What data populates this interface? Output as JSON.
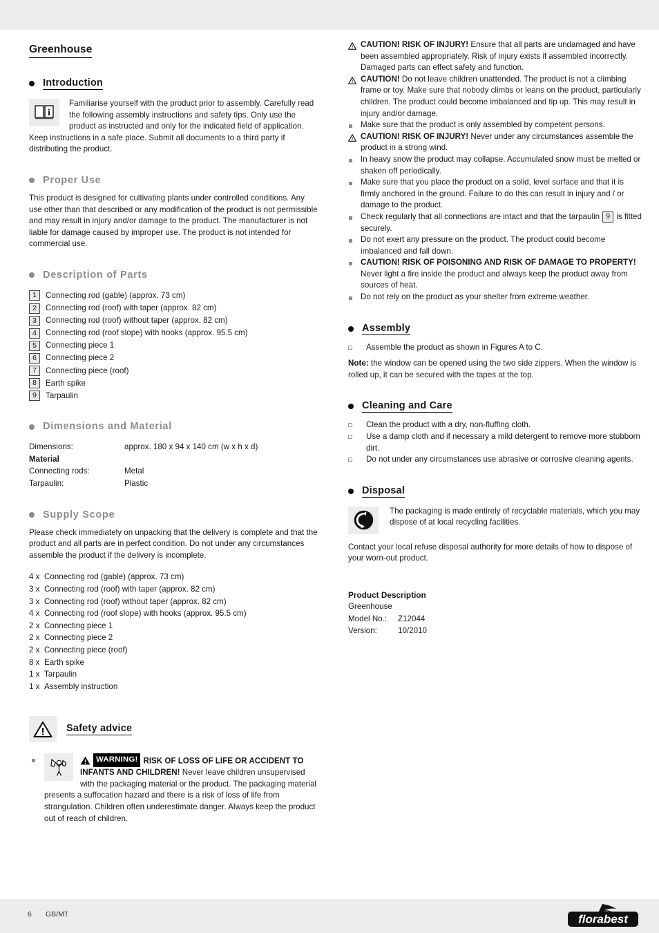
{
  "document": {
    "title": "Greenhouse"
  },
  "sections": {
    "introduction": {
      "heading": "Introduction",
      "icon": "manual-book-icon",
      "body": "Familiarise yourself with the product prior to assembly. Carefully read the following assembly instructions and safety tips. Only use the product as instructed and only for the indicated field of application. Keep instructions in a safe place. Submit all documents to a third party if distributing the product."
    },
    "proper_use": {
      "heading": "Proper Use",
      "body": "This product is designed for cultivating plants under controlled conditions. Any use other than that described or any modification of the product is not permissible and may result in injury and/or damage to the product. The manufacturer is not liable for damage caused by improper use. The product is not intended for commercial use."
    },
    "description_of_parts": {
      "heading": "Description of Parts",
      "parts": [
        {
          "num": "1",
          "label": "Connecting rod (gable) (approx. 73 cm)"
        },
        {
          "num": "2",
          "label": "Connecting rod (roof) with taper (approx. 82 cm)"
        },
        {
          "num": "3",
          "label": "Connecting rod (roof) without taper (approx. 82 cm)"
        },
        {
          "num": "4",
          "label": "Connecting rod (roof slope) with hooks (approx. 95.5 cm)"
        },
        {
          "num": "5",
          "label": "Connecting piece 1"
        },
        {
          "num": "6",
          "label": "Connecting piece 2"
        },
        {
          "num": "7",
          "label": "Connecting piece (roof)"
        },
        {
          "num": "8",
          "label": "Earth spike"
        },
        {
          "num": "9",
          "label": "Tarpaulin"
        }
      ]
    },
    "dimensions_and_material": {
      "heading": "Dimensions and Material",
      "rows": [
        {
          "key": "Dimensions:",
          "value": "approx. 180 x 94 x 140 cm (w x h x d)",
          "bold": false
        },
        {
          "key": "Material",
          "value": "",
          "bold": true
        },
        {
          "key": "Connecting rods:",
          "value": "Metal",
          "bold": false
        },
        {
          "key": "Tarpaulin:",
          "value": "Plastic",
          "bold": false
        }
      ]
    },
    "supply_scope": {
      "heading": "Supply Scope",
      "intro": "Please check immediately on unpacking that the delivery is complete and that the product and all parts are in perfect condition. Do not under any circumstances assemble the product if the delivery is incomplete.",
      "items": [
        {
          "qty": "4 x",
          "label": "Connecting rod (gable) (approx. 73 cm)"
        },
        {
          "qty": "3 x",
          "label": "Connecting rod (roof) with taper (approx. 82 cm)"
        },
        {
          "qty": "3 x",
          "label": "Connecting rod (roof) without taper (approx. 82 cm)"
        },
        {
          "qty": "4 x",
          "label": "Connecting rod (roof slope) with hooks (approx. 95.5 cm)"
        },
        {
          "qty": "2 x",
          "label": "Connecting piece 1"
        },
        {
          "qty": "2 x",
          "label": "Connecting piece 2"
        },
        {
          "qty": "2 x",
          "label": "Connecting piece (roof)"
        },
        {
          "qty": "8 x",
          "label": "Earth spike"
        },
        {
          "qty": "1 x",
          "label": "Tarpaulin"
        },
        {
          "qty": "1 x",
          "label": "Assembly instruction"
        }
      ]
    },
    "safety_advice": {
      "heading": "Safety advice",
      "warning": {
        "badge_word": "WARNING!",
        "bold_lead": "RISK OF LOSS OF LIFE OR ACCIDENT TO INFANTS AND CHILDREN!",
        "rest": " Never leave children unsupervised with the packaging material or the product. The packaging material presents a suffocation hazard and there is a risk of loss of life from strangulation. Children often underestimate danger. Always keep the product out of reach of children."
      }
    },
    "cautions": {
      "items": [
        {
          "mark": "triangle",
          "bold": "CAUTION! RISK OF INJURY!",
          "text": " Ensure that all parts are undamaged and have been assembled appropriately. Risk of injury exists if assembled incorrectly. Damaged parts can effect safety and function."
        },
        {
          "mark": "triangle",
          "bold": "CAUTION!",
          "text": " Do not leave children unattended. The product is not a climbing frame or toy. Make sure that nobody climbs or leans on the product, particularly children. The product could become imbalanced and tip up. This may result in injury and/or damage."
        },
        {
          "mark": "square",
          "bold": "",
          "text": "Make sure that the product is only assembled by competent persons."
        },
        {
          "mark": "triangle",
          "bold": "CAUTION! RISK OF INJURY!",
          "text": " Never under any circumstances assemble the product in a strong wind."
        },
        {
          "mark": "square",
          "bold": "",
          "text": "In heavy snow the product may collapse. Accumulated  snow must be melted or shaken off periodically."
        },
        {
          "mark": "square",
          "bold": "",
          "text": "Make sure that you place the product on a solid, level surface and that it is firmly anchored in the ground. Failure to do this can result in injury and / or damage to the product."
        },
        {
          "mark": "square",
          "bold": "",
          "text_before_ref": "Check regularly that all connections are intact and that the tarpaulin ",
          "ref": "9",
          "text_after_ref": " is fitted securely."
        },
        {
          "mark": "square",
          "bold": "",
          "text": "Do not exert any pressure on the product. The product could become imbalanced and fall down."
        },
        {
          "mark": "square",
          "bold": "CAUTION! RISK OF POISONING AND RISK OF DAMAGE TO PROPERTY!",
          "text": " Never light a fire inside the product and always keep the product away from sources of heat."
        },
        {
          "mark": "square",
          "bold": "",
          "text": "Do not rely on the product as your shelter from extreme weather."
        }
      ]
    },
    "assembly": {
      "heading": "Assembly",
      "items": [
        "Assemble the product as shown in Figures A to C."
      ],
      "note_label": "Note:",
      "note_text": " the window can be opened using the two side zippers. When the window is rolled up, it can be secured with the tapes at the top."
    },
    "cleaning_and_care": {
      "heading": "Cleaning and Care",
      "items": [
        "Clean the product with a dry, non-fluffing cloth.",
        "Use a damp cloth and if necessary a mild detergent to remove more stubborn dirt.",
        "Do not under any circumstances use abrasive or corrosive cleaning agents."
      ]
    },
    "disposal": {
      "heading": "Disposal",
      "icon": "green-dot-recycling-icon",
      "icon_text": "The packaging is made entirely of recyclable materials, which you may dispose of at local recycling facilities.",
      "body": "Contact your local refuse disposal authority for more details of how to dispose of your worn-out product."
    },
    "product_description": {
      "heading": "Product Description",
      "name": "Greenhouse",
      "rows": [
        {
          "key": "Model No.:",
          "value": "Z12044"
        },
        {
          "key": "Version:",
          "value": "10/2010"
        }
      ]
    }
  },
  "footer": {
    "page_number": "6",
    "locale": "GB/MT",
    "brand": "florabest"
  },
  "colors": {
    "band": "#ebeded",
    "gray_heading": "#8c8c91",
    "icon_bg": "#ececec",
    "text": "#1a1a1a"
  }
}
